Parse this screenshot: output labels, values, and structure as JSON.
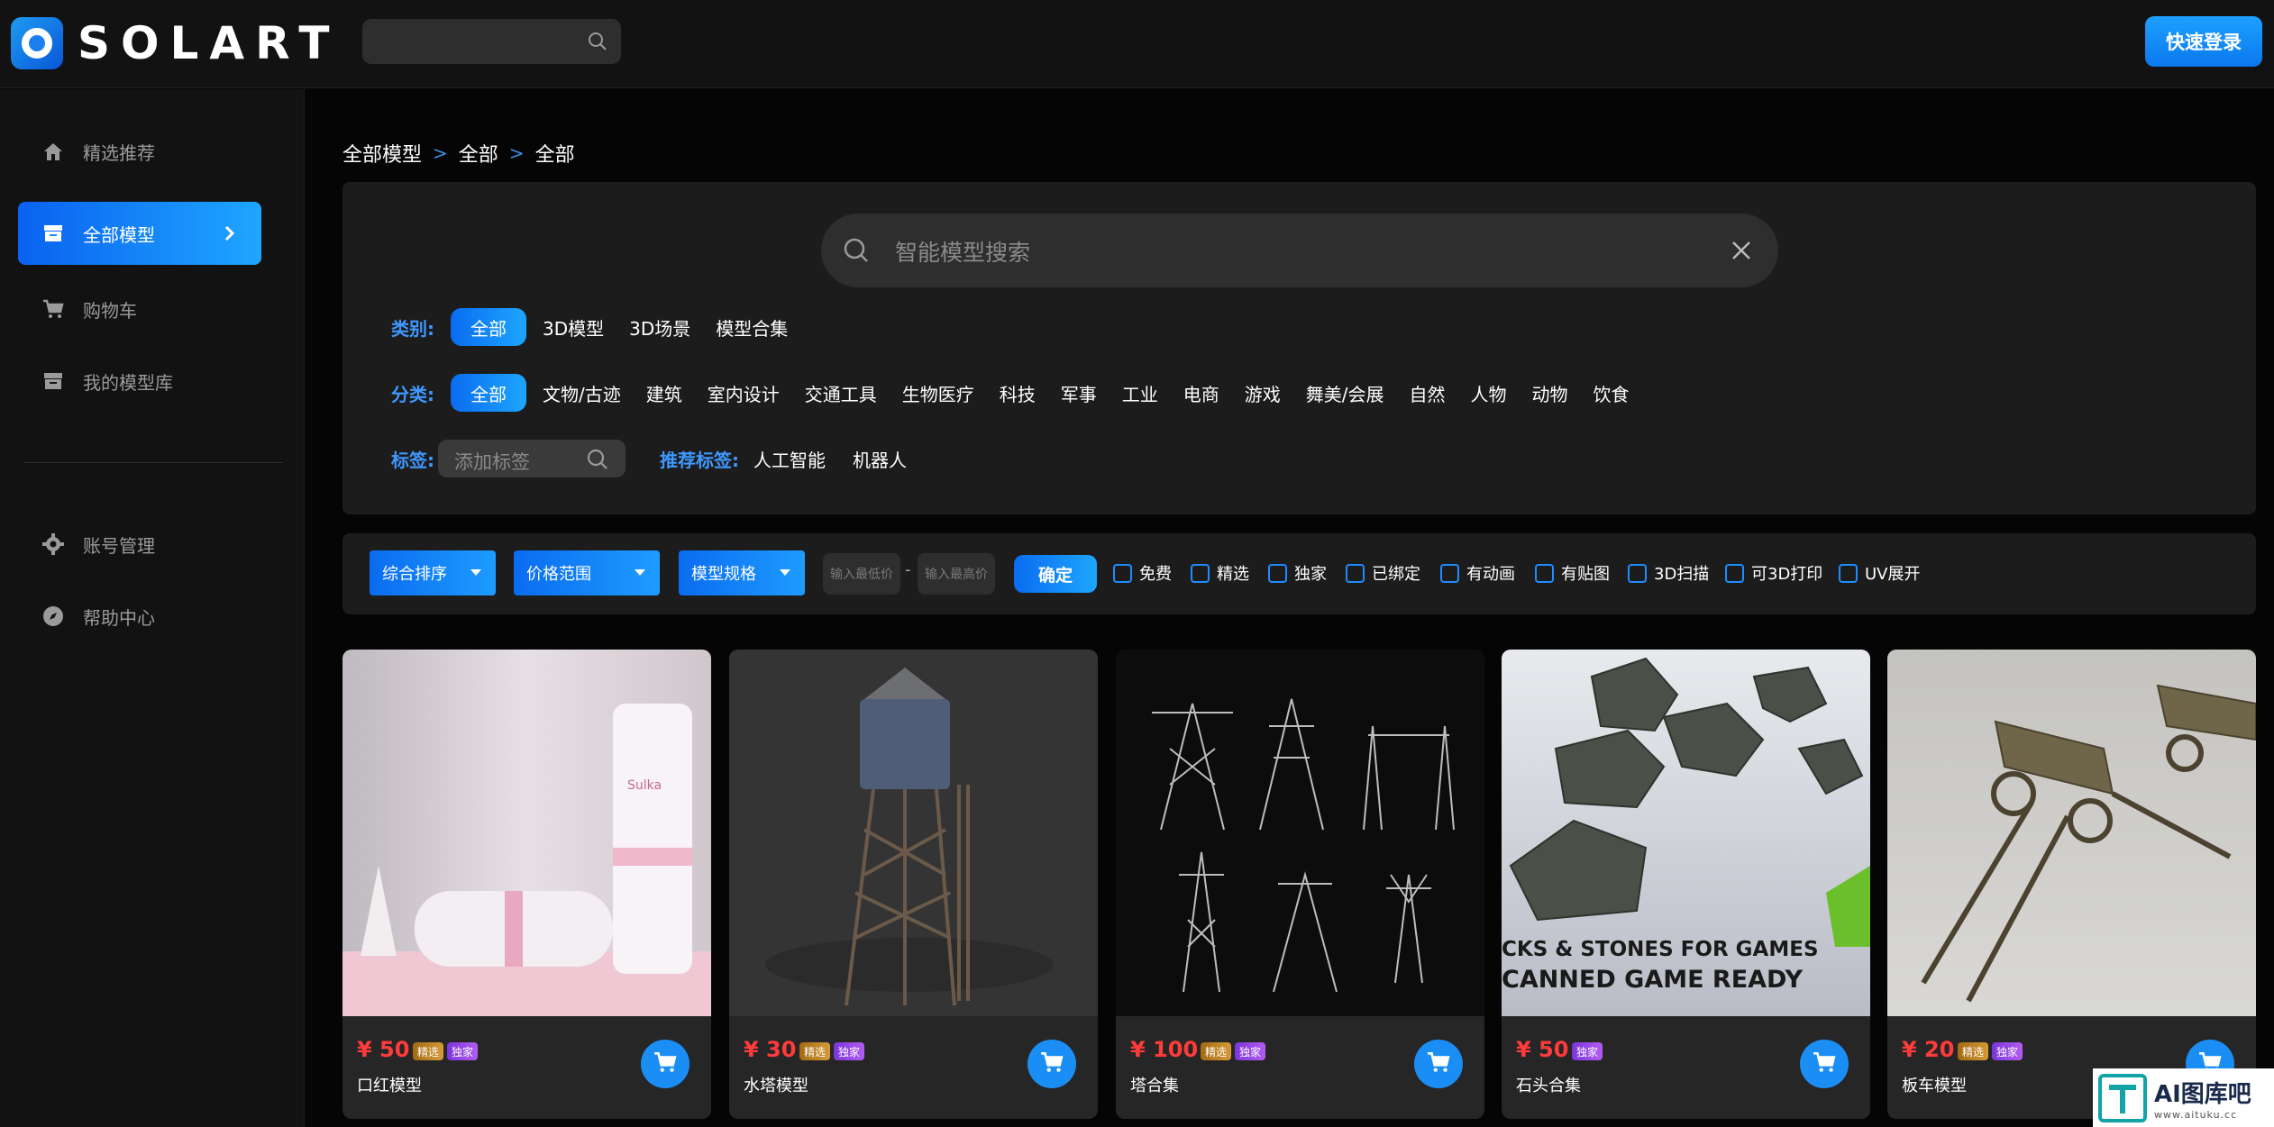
{
  "app": {
    "brand": "SOLART",
    "top_search_placeholder": "",
    "login_label": "快速登录"
  },
  "sidebar": {
    "items": [
      {
        "label": "精选推荐",
        "icon": "home-icon"
      },
      {
        "label": "全部模型",
        "icon": "box-icon",
        "active": true
      },
      {
        "label": "购物车",
        "icon": "cart-icon"
      },
      {
        "label": "我的模型库",
        "icon": "archive-icon"
      }
    ],
    "items2": [
      {
        "label": "账号管理",
        "icon": "gear-icon"
      },
      {
        "label": "帮助中心",
        "icon": "compass-icon"
      }
    ]
  },
  "breadcrumb": [
    "全部模型",
    "全部",
    "全部"
  ],
  "search": {
    "placeholder": "智能模型搜索"
  },
  "filters": {
    "category_label": "类别:",
    "categories": [
      "全部",
      "3D模型",
      "3D场景",
      "模型合集"
    ],
    "class_label": "分类:",
    "classes": [
      "全部",
      "文物/古迹",
      "建筑",
      "室内设计",
      "交通工具",
      "生物医疗",
      "科技",
      "军事",
      "工业",
      "电商",
      "游戏",
      "舞美/会展",
      "自然",
      "人物",
      "动物",
      "饮食"
    ],
    "tag_label": "标签:",
    "tag_placeholder": "添加标签",
    "recommended_label": "推荐标签:",
    "recommended": [
      "人工智能",
      "机器人"
    ]
  },
  "sortbar": {
    "sort_label": "综合排序",
    "price_label": "价格范围",
    "spec_label": "模型规格",
    "min_placeholder": "输入最低价",
    "max_placeholder": "输入最高价",
    "dash": "-",
    "confirm_label": "确定",
    "checkboxes": [
      "免费",
      "精选",
      "独家",
      "已绑定",
      "有动画",
      "有贴图",
      "3D扫描",
      "可3D打印",
      "UV展开"
    ]
  },
  "products": [
    {
      "price": "¥ 50",
      "name": "口红模型",
      "badges": [
        "精选",
        "独家"
      ]
    },
    {
      "price": "¥ 30",
      "name": "水塔模型",
      "badges": [
        "精选",
        "独家"
      ]
    },
    {
      "price": "¥ 100",
      "name": "塔合集",
      "badges": [
        "精选",
        "独家"
      ]
    },
    {
      "price": "¥ 50",
      "name": "石头合集",
      "badges": [
        "独家"
      ],
      "overlay_line1": "CKS & STONES FOR GAMES",
      "overlay_line2": "CANNED GAME READY"
    },
    {
      "price": "¥ 20",
      "name": "板车模型",
      "badges": [
        "精选",
        "独家"
      ]
    }
  ],
  "cosmetic_product": {
    "label": "Sulka"
  },
  "watermark": {
    "title": "AI图库吧",
    "url": "www.aituku.cc"
  },
  "colors": {
    "accent": "#1e8cff",
    "price": "#ff3b3b",
    "bg": "#050505",
    "panel": "#1c1c1c"
  }
}
